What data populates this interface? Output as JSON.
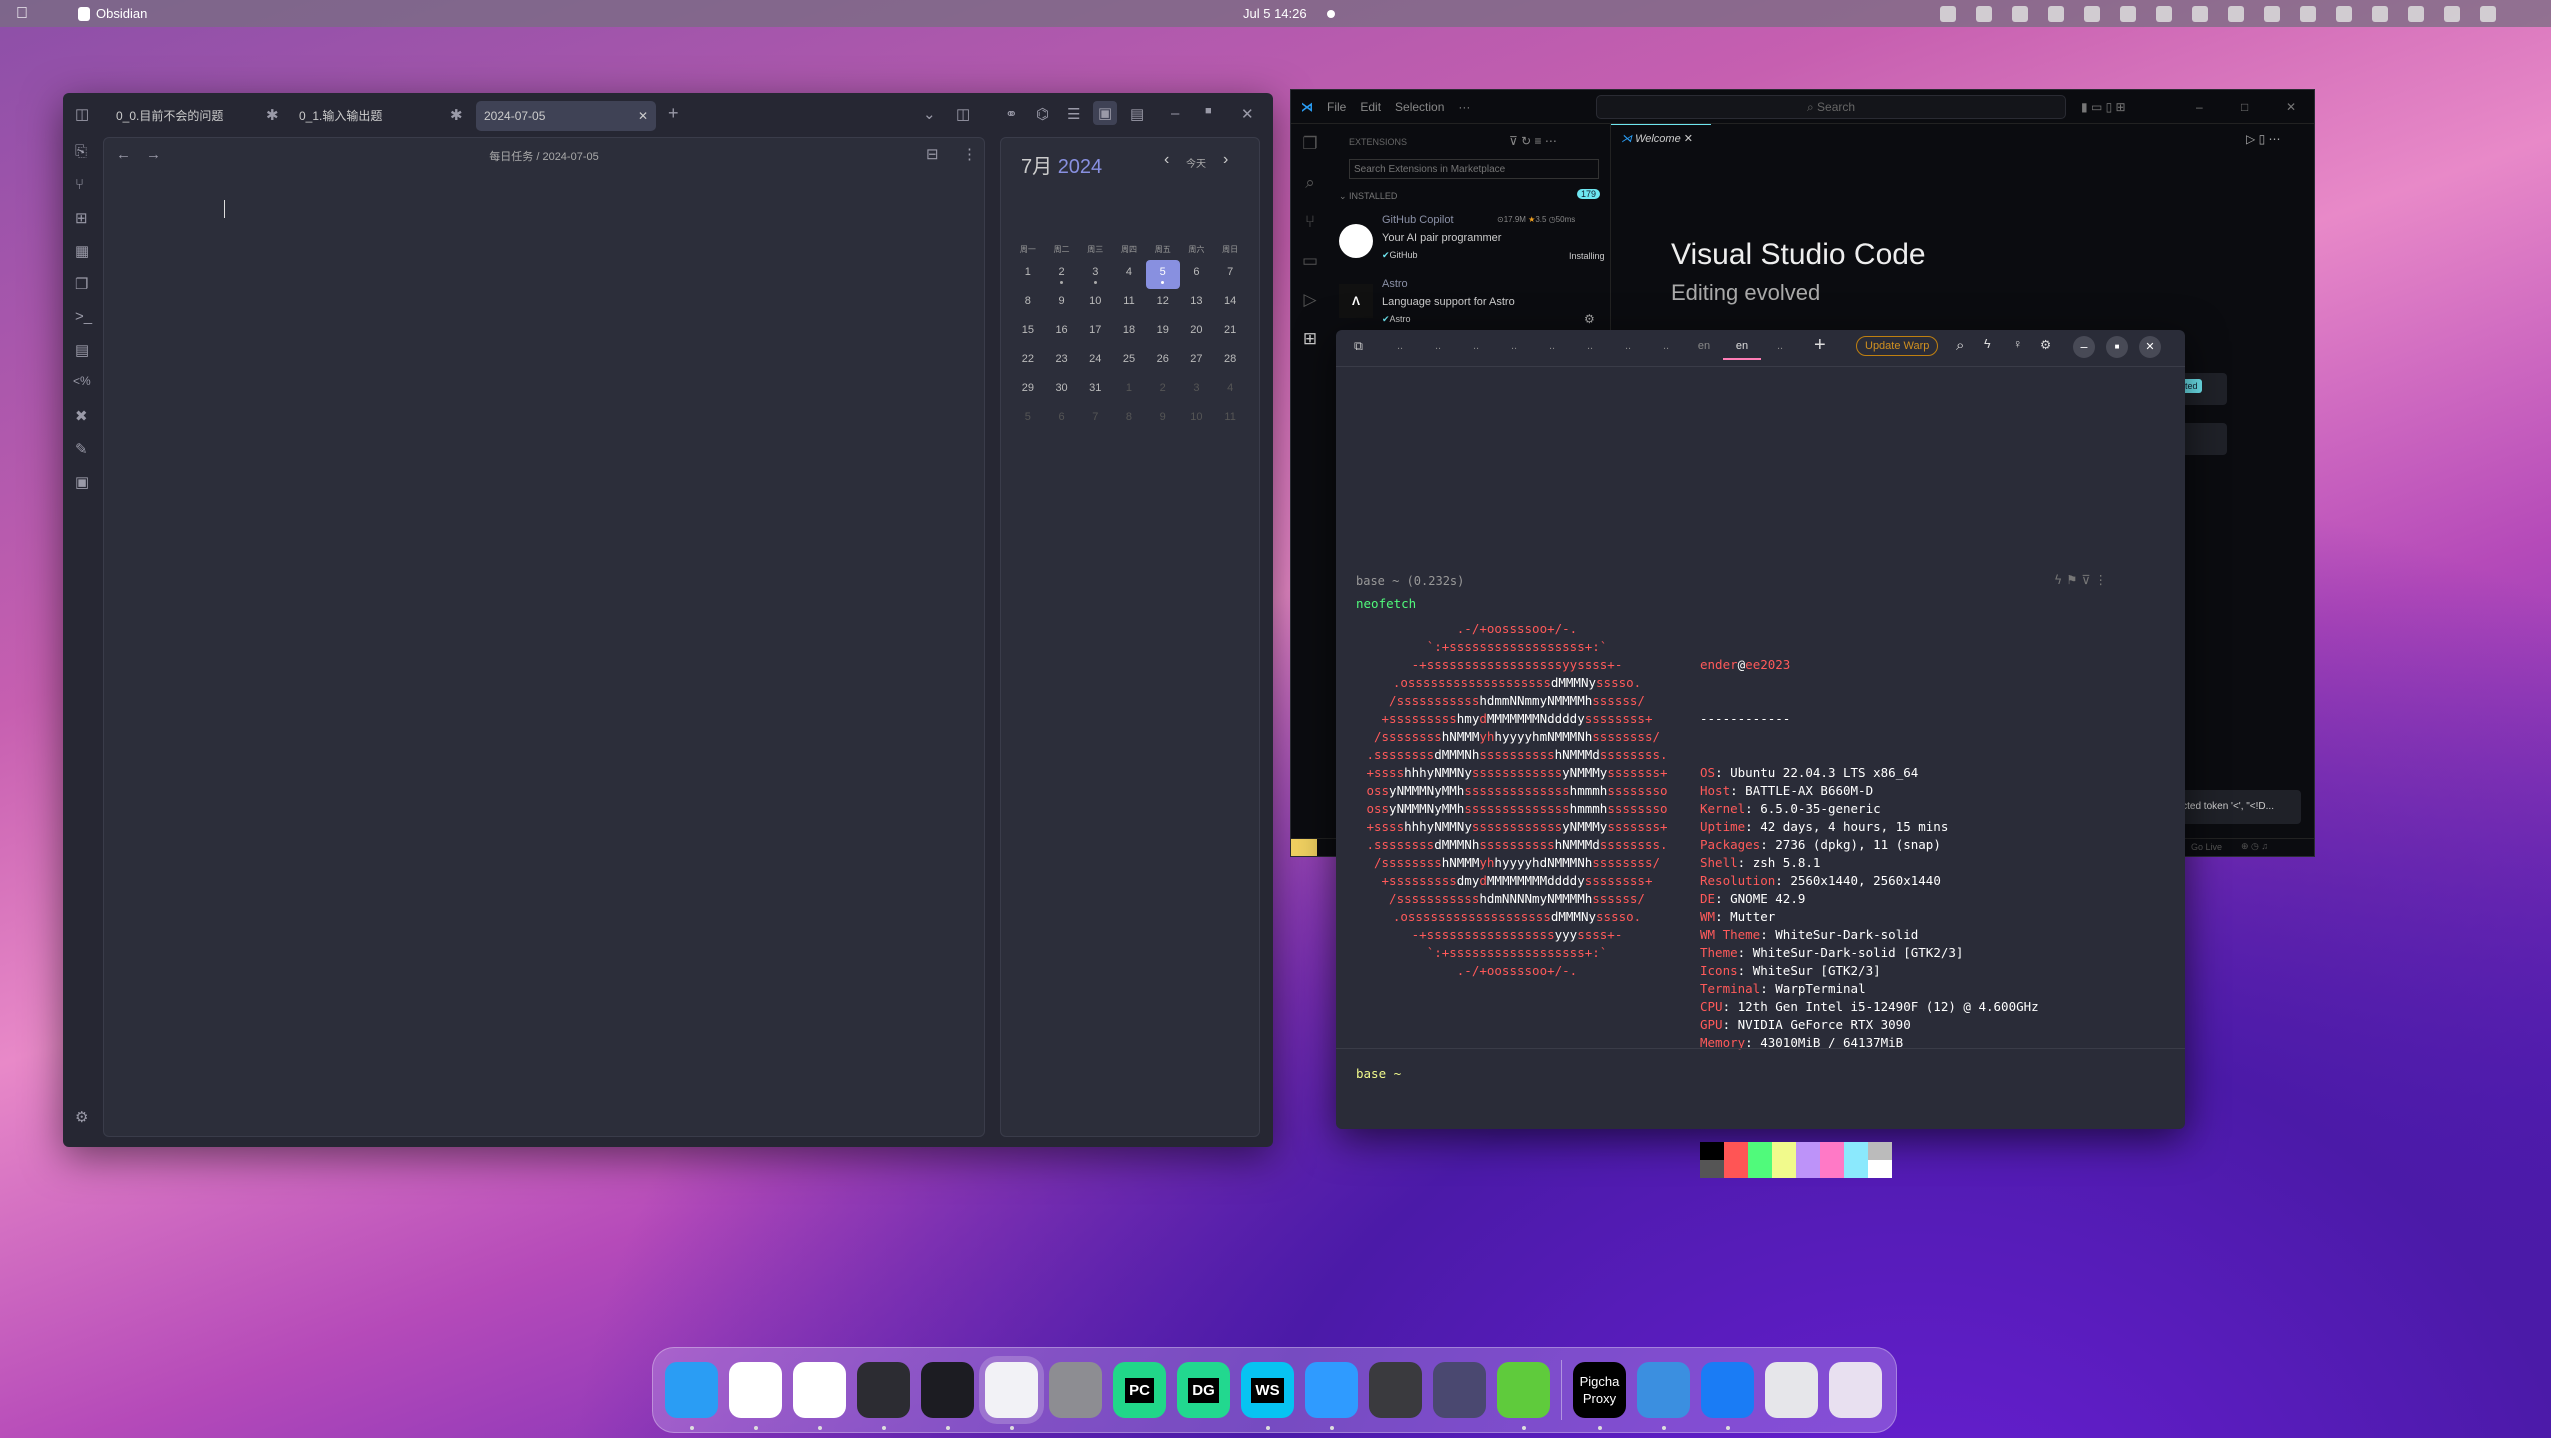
{
  "menubar": {
    "app": "Obsidian",
    "clock": "Jul 5  14:26",
    "tray_icons": [
      "warp-icon",
      "app-icon",
      "app-icon",
      "app-icon",
      "app-icon",
      "app-icon",
      "app-icon",
      "app-icon",
      "battery-icon",
      "app-icon",
      "app-icon",
      "app-icon",
      "app-icon",
      "network-icon",
      "volume-icon",
      "power-icon"
    ]
  },
  "obsidian": {
    "tabs": [
      {
        "label": "0_0.目前不会的问题",
        "pinned": true
      },
      {
        "label": "0_1.输入输出题",
        "pinned": true
      },
      {
        "label": "2024-07-05",
        "active": true
      }
    ],
    "breadcrumb": {
      "folder": "每日任务",
      "sep": "/",
      "file": "2024-07-05"
    },
    "calendar": {
      "month": "7月",
      "year": "2024",
      "today": "今天",
      "weekdays": [
        "周一",
        "周二",
        "周三",
        "周四",
        "周五",
        "周六",
        "周日"
      ],
      "weeks": [
        [
          "1",
          "2",
          "3",
          "4",
          "5",
          "6",
          "7"
        ],
        [
          "8",
          "9",
          "10",
          "11",
          "12",
          "13",
          "14"
        ],
        [
          "15",
          "16",
          "17",
          "18",
          "19",
          "20",
          "21"
        ],
        [
          "22",
          "23",
          "24",
          "25",
          "26",
          "27",
          "28"
        ],
        [
          "29",
          "30",
          "31",
          "1",
          "2",
          "3",
          "4"
        ],
        [
          "5",
          "6",
          "7",
          "8",
          "9",
          "10",
          "11"
        ]
      ],
      "selected": "5",
      "dots": [
        "2",
        "3",
        "5"
      ],
      "accent": "#8890e0"
    }
  },
  "vscode": {
    "menu": [
      "File",
      "Edit",
      "Selection",
      "···"
    ],
    "search": "Search",
    "sidebar": {
      "title": "EXTENSIONS",
      "search_placeholder": "Search Extensions in Marketplace",
      "section": "INSTALLED",
      "count": "179",
      "extensions": [
        {
          "name": "GitHub Copilot",
          "desc": "Your AI pair programmer",
          "publisher": "GitHub",
          "downloads": "17.9M",
          "rating": "3.5",
          "time": "50ms",
          "status": "Installing"
        },
        {
          "name": "Astro",
          "desc": "Language support for Astro",
          "publisher": "Astro"
        }
      ]
    },
    "tab": "Welcome",
    "welcome": {
      "title": "Visual Studio Code",
      "subtitle": "Editing evolved"
    },
    "badge": "dated",
    "notification": "pected token '<', \"<!D...",
    "status": {
      "golive": "Go Live"
    }
  },
  "warp": {
    "tabs": [
      "..",
      "..",
      "..",
      "..",
      "..",
      "..",
      "..",
      "..",
      "en",
      "en",
      ".."
    ],
    "update": "Update Warp",
    "block_header": "base ~ (0.232s)",
    "command": "neofetch",
    "ascii": [
      [
        ".-/+oossssoo+/-."
      ],
      [
        "`:+ssssssssssssssssss+:`"
      ],
      [
        "-+ssssssssssssssssssyyssss+-"
      ],
      [
        ".osssssssssssssssssss",
        "dMMMNy",
        "sssso."
      ],
      [
        "/sssssssssss",
        "hdmmNNmmyNMMMMh",
        "ssssss/"
      ],
      [
        "+sssssssss",
        "hmy",
        "d",
        "MMMMMMMNddddy",
        "ssssssss+"
      ],
      [
        "/ssssssss",
        "hNMMM",
        "yh",
        "hyyyyhmNMMMNh",
        "ssssssss/"
      ],
      [
        ".ssssssss",
        "dMMMNh",
        "ssssssssss",
        "hNMMMd",
        "ssssssss."
      ],
      [
        "+ssss",
        "hhhyNMMNy",
        "ssssssssssss",
        "yNMMMy",
        "sssssss+"
      ],
      [
        "oss",
        "yNMMMNyMMh",
        "ssssssssssssss",
        "hmmmh",
        "ssssssso"
      ],
      [
        "oss",
        "yNMMMNyMMh",
        "ssssssssssssss",
        "hmmmh",
        "ssssssso"
      ],
      [
        "+ssss",
        "hhhyNMMNy",
        "ssssssssssss",
        "yNMMMy",
        "sssssss+"
      ],
      [
        ".ssssssss",
        "dMMMNh",
        "ssssssssss",
        "hNMMMd",
        "ssssssss."
      ],
      [
        "/ssssssss",
        "hNMMM",
        "yh",
        "hyyyyhdNMMMNh",
        "ssssssss/"
      ],
      [
        "+sssssssss",
        "dmy",
        "d",
        "MMMMMMMMddddy",
        "ssssssss+"
      ],
      [
        "/sssssssssss",
        "hdmNNNNmyNMMMMh",
        "ssssss/"
      ],
      [
        ".osssssssssssssssssss",
        "dMMMNy",
        "sssso."
      ],
      [
        "-+sssssssssssssssss",
        "yyy",
        "ssss+-"
      ],
      [
        "`:+ssssssssssssssssss+:`"
      ],
      [
        ".-/+oossssoo+/-."
      ]
    ],
    "user": "ender",
    "at": "@",
    "host": "ee2023",
    "divider": "------------",
    "info": [
      [
        "OS",
        "Ubuntu 22.04.3 LTS x86_64"
      ],
      [
        "Host",
        "BATTLE-AX B660M-D"
      ],
      [
        "Kernel",
        "6.5.0-35-generic"
      ],
      [
        "Uptime",
        "42 days, 4 hours, 15 mins"
      ],
      [
        "Packages",
        "2736 (dpkg), 11 (snap)"
      ],
      [
        "Shell",
        "zsh 5.8.1"
      ],
      [
        "Resolution",
        "2560x1440, 2560x1440"
      ],
      [
        "DE",
        "GNOME 42.9"
      ],
      [
        "WM",
        "Mutter"
      ],
      [
        "WM Theme",
        "WhiteSur-Dark-solid"
      ],
      [
        "Theme",
        "WhiteSur-Dark-solid [GTK2/3]"
      ],
      [
        "Icons",
        "WhiteSur [GTK2/3]"
      ],
      [
        "Terminal",
        "WarpTerminal"
      ],
      [
        "CPU",
        "12th Gen Intel i5-12490F (12) @ 4.600GHz"
      ],
      [
        "GPU",
        "NVIDIA GeForce RTX 3090"
      ],
      [
        "Memory",
        "43010MiB / 64137MiB"
      ]
    ],
    "palette_top": [
      "#000000",
      "#ff5555",
      "#50fa7b",
      "#f1fa8c",
      "#bd93f9",
      "#ff79c6",
      "#8be9fd",
      "#bbbbbb"
    ],
    "palette_bottom": [
      "#555555",
      "#ff5555",
      "#50fa7b",
      "#f1fa8c",
      "#bd93f9",
      "#ff79c6",
      "#8be9fd",
      "#ffffff"
    ],
    "prompt": "base ~"
  },
  "dock": [
    {
      "icon": "finder-icon",
      "bg": "#2a9df4",
      "running": true
    },
    {
      "icon": "chrome-icon",
      "bg": "#ffffff",
      "running": true
    },
    {
      "icon": "paper-plane-icon",
      "bg": "#ffffff",
      "running": true
    },
    {
      "icon": "vscode-icon",
      "bg": "#2c2c32",
      "running": true
    },
    {
      "icon": "warp-icon",
      "bg": "#1c1c22",
      "running": true
    },
    {
      "icon": "obsidian-icon",
      "bg": "#f2f2f6",
      "running": true
    },
    {
      "icon": "settings-icon",
      "bg": "#8d8d92",
      "running": false
    },
    {
      "icon": "pycharm-icon",
      "label": "PC",
      "bg": "#21d789",
      "running": false
    },
    {
      "icon": "datagrip-icon",
      "label": "DG",
      "bg": "#22d88f",
      "running": false
    },
    {
      "icon": "webstorm-icon",
      "label": "WS",
      "bg": "#07c3f2",
      "running": true
    },
    {
      "icon": "chat-icon",
      "bg": "#2f9bff",
      "running": true
    },
    {
      "icon": "screenshot-icon",
      "bg": "#3a3a3e",
      "running": false
    },
    {
      "icon": "cat-icon",
      "bg": "#4a4870",
      "running": false
    },
    {
      "icon": "wechat-icon",
      "bg": "#5fcb3c",
      "running": true
    },
    {
      "icon": "pigcha-proxy-icon",
      "label": "Pigcha Proxy",
      "bg": "#000000",
      "running": true
    },
    {
      "icon": "image-viewer-icon",
      "bg": "#3b8fe0",
      "running": true
    },
    {
      "icon": "app-store-icon",
      "bg": "#1a7cf5",
      "running": true
    },
    {
      "icon": "trash-icon",
      "bg": "#e6e6ea",
      "running": false
    },
    {
      "icon": "launchpad-icon",
      "bg": "#e8e0f0",
      "running": false
    }
  ]
}
